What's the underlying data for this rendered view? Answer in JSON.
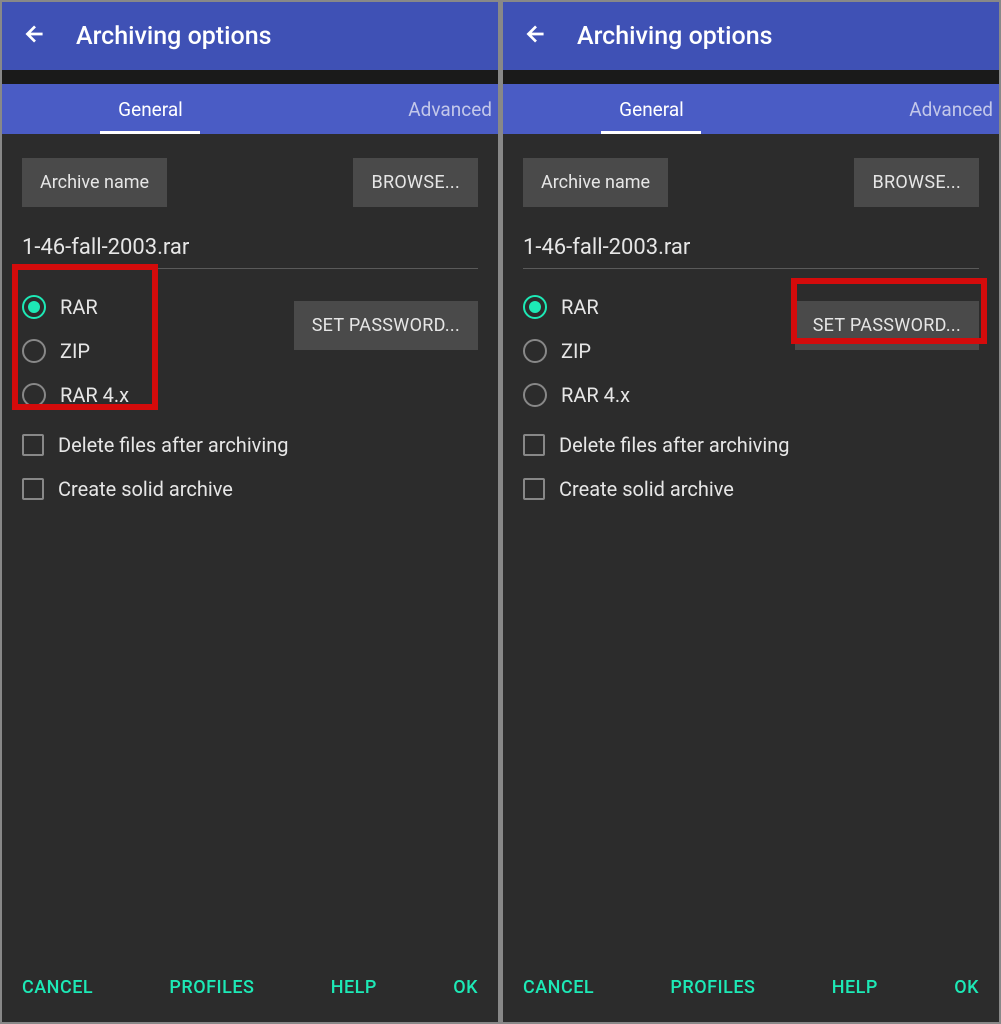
{
  "screens": {
    "left": {
      "title": "Archiving options",
      "tabs": {
        "general": "General",
        "advanced": "Advanced"
      },
      "archive_name_label": "Archive name",
      "browse_label": "BROWSE...",
      "filename": "1-46-fall-2003.rar",
      "set_password_label": "SET PASSWORD...",
      "formats": {
        "rar": "RAR",
        "zip": "ZIP",
        "rar4x": "RAR 4.x"
      },
      "selected_format": "rar",
      "checkboxes": {
        "delete_after": "Delete files after archiving",
        "solid": "Create solid archive"
      },
      "footer": {
        "cancel": "CANCEL",
        "profiles": "PROFILES",
        "help": "HELP",
        "ok": "OK"
      },
      "highlight": "radios"
    },
    "right": {
      "title": "Archiving options",
      "tabs": {
        "general": "General",
        "advanced": "Advanced"
      },
      "archive_name_label": "Archive name",
      "browse_label": "BROWSE...",
      "filename": "1-46-fall-2003.rar",
      "set_password_label": "SET PASSWORD...",
      "formats": {
        "rar": "RAR",
        "zip": "ZIP",
        "rar4x": "RAR 4.x"
      },
      "selected_format": "rar",
      "checkboxes": {
        "delete_after": "Delete files after archiving",
        "solid": "Create solid archive"
      },
      "footer": {
        "cancel": "CANCEL",
        "profiles": "PROFILES",
        "help": "HELP",
        "ok": "OK"
      },
      "highlight": "password"
    }
  },
  "colors": {
    "accent": "#1de9b6",
    "primary": "#3f51b5",
    "highlight": "#d40b0b"
  }
}
